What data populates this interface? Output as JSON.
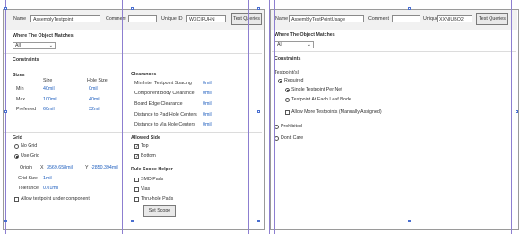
{
  "left": {
    "name_label": "Name",
    "name_value": "AssemblyTestpoint",
    "comment_label": "Comment",
    "comment_value": "",
    "uid_label": "Unique ID",
    "uid_value": "WXCIFUHN",
    "test_button": "Test Queries",
    "where_label": "Where The Object Matches",
    "where_value": "All",
    "constraints": "Constraints",
    "sizes": {
      "title": "Sizes",
      "col_size": "Size",
      "col_hole": "Hole Size",
      "rows": [
        {
          "label": "Min",
          "size": "40mil",
          "hole": "0mil"
        },
        {
          "label": "Max",
          "size": "100mil",
          "hole": "40mil"
        },
        {
          "label": "Preferred",
          "size": "60mil",
          "hole": "32mil"
        }
      ]
    },
    "clearances": {
      "title": "Clearances",
      "rows": [
        {
          "label": "Min Inter Testpoint Spacing",
          "value": "0mil"
        },
        {
          "label": "Component Body Clearance",
          "value": "0mil"
        },
        {
          "label": "Board Edge Clearance",
          "value": "0mil"
        },
        {
          "label": "Distance to Pad Hole Centers",
          "value": "0mil"
        },
        {
          "label": "Distance to Via Hole Centers",
          "value": "0mil"
        }
      ]
    },
    "grid": {
      "title": "Grid",
      "no_grid": "No Grid",
      "use_grid": "Use Grid",
      "origin_label": "Origin",
      "x_label": "X",
      "x_value": "3569.658mil",
      "y_label": "Y",
      "y_value": "-2850.394mil",
      "grid_size_label": "Grid Size",
      "grid_size_value": "1mil",
      "tolerance_label": "Tolerance",
      "tolerance_value": "0.01mil",
      "allow_under": "Allow testpoint under component"
    },
    "allowed_side": {
      "title": "Allowed Side",
      "top": "Top",
      "bottom": "Bottom"
    },
    "rule_scope": {
      "title": "Rule Scope Helper",
      "smd": "SMD Pads",
      "vias": "Vias",
      "thru": "Thru-hole Pads",
      "set_scope": "Set Scope"
    }
  },
  "right": {
    "name_label": "Name",
    "name_value": "AssemblyTestPointUsage",
    "comment_label": "Comment",
    "comment_value": "",
    "uid_label": "Unique ID",
    "uid_value": "XXNIUBO2",
    "test_button": "Test Queries",
    "where_label": "Where The Object Matches",
    "where_value": "All",
    "constraints": "Constraints",
    "testpoint_label": "Testpoint(s)",
    "required": "Required",
    "single": "Single Testpoint Per Net",
    "each_leaf": "Testpoint At Each Leaf Node",
    "allow_more": "Allow More Testpoints (Manually Assigned)",
    "prohibited": "Prohibited",
    "dont_care": "Don't Care"
  }
}
